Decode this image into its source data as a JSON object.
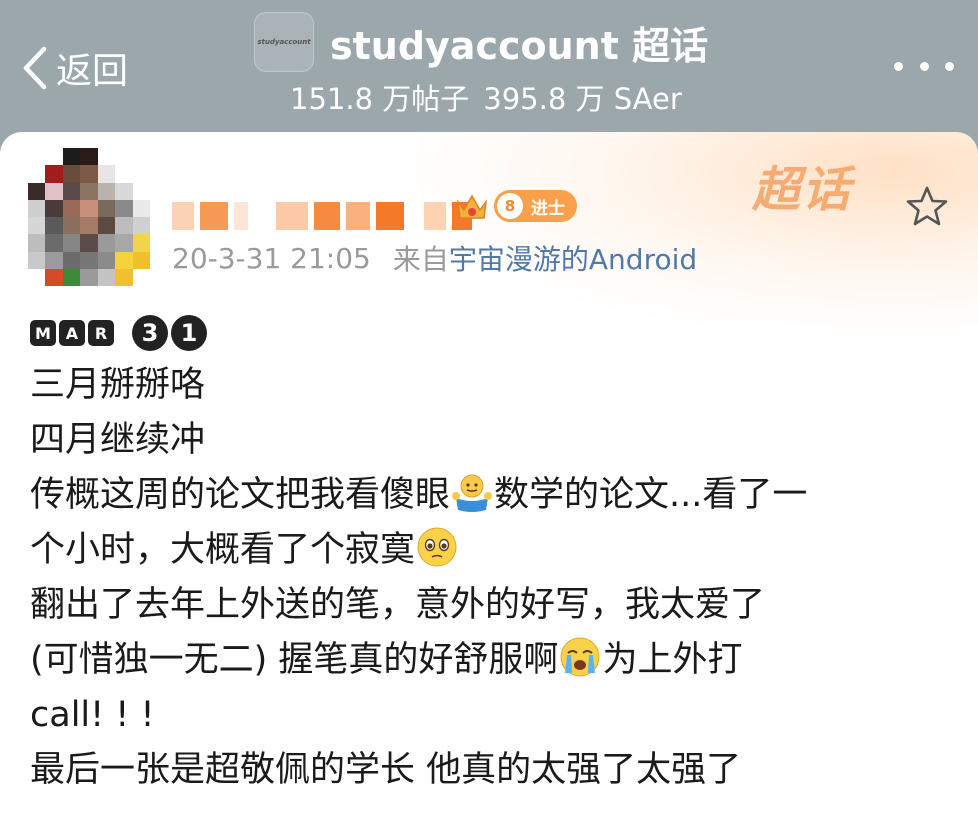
{
  "header": {
    "back_label": "返回",
    "logo_text": "studyaccount",
    "title": "studyaccount 超话",
    "stats": {
      "posts": "151.8 万帖子",
      "followers": "395.8 万 SAer"
    }
  },
  "post": {
    "watermark": "超话",
    "level_number": "8",
    "level_title": "进士",
    "timestamp": "20-3-31 21:05",
    "source_prefix": "来自",
    "source": "宇宙漫游的Android",
    "date_badge": {
      "letters": [
        "M",
        "A",
        "R"
      ],
      "digits": [
        "3",
        "1"
      ]
    },
    "lines": [
      {
        "text": "三月掰掰咯"
      },
      {
        "text": "四月继续冲"
      },
      {
        "text": "传概这周的论文把我看傻眼",
        "emoji": "shrug-emoji",
        "after": "数学的论文...看了一"
      },
      {
        "text": "个小时，大概看了个寂寞",
        "emoji": "pleading-emoji"
      },
      {
        "text": "翻出了去年上外送的笔，意外的好写，我太爱了"
      },
      {
        "text": "(可惜独一无二) 握笔真的好舒服啊",
        "emoji": "crying-emoji",
        "after": "为上外打"
      },
      {
        "text": " call! ! !"
      },
      {
        "text": "最后一张是超敬佩的学长 他真的太强了太强了"
      }
    ]
  },
  "colors": {
    "topbar": "#9ca7ac",
    "accent": "#f9a04c",
    "link": "#5079a9",
    "meta": "#9a9a9a"
  }
}
